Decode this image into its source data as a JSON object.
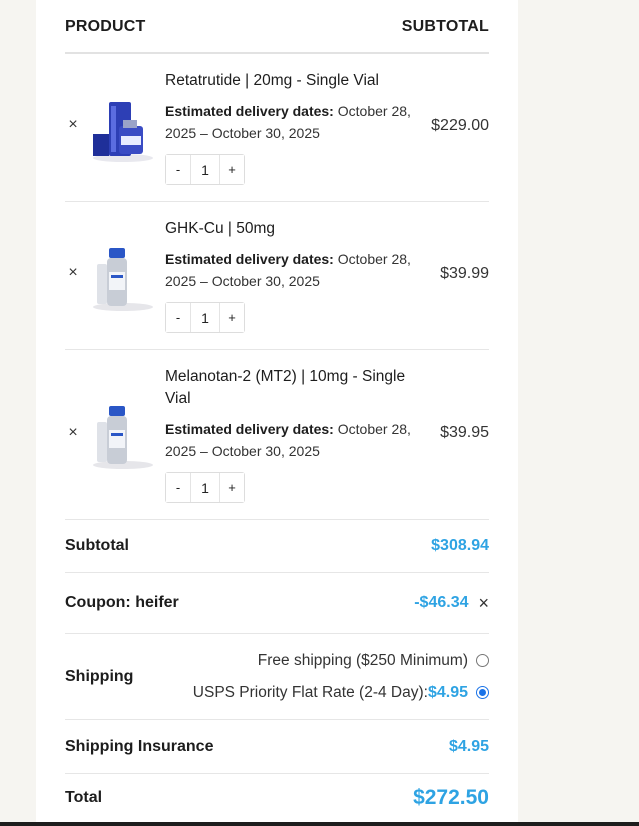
{
  "header": {
    "product": "PRODUCT",
    "subtotal": "SUBTOTAL"
  },
  "items": [
    {
      "name": "Retatrutide | 20mg - Single Vial",
      "delivery_label": "Estimated delivery dates:",
      "delivery_dates": " October 28, 2025 – October 30, 2025",
      "qty": "1",
      "price": "$229.00",
      "remove": "×"
    },
    {
      "name": "GHK-Cu | 50mg",
      "delivery_label": "Estimated delivery dates:",
      "delivery_dates": " October 28, 2025 – October 30, 2025",
      "qty": "1",
      "price": "$39.99",
      "remove": "×"
    },
    {
      "name": "Melanotan-2 (MT2) | 10mg - Single Vial",
      "delivery_label": "Estimated delivery dates:",
      "delivery_dates": " October 28, 2025 – October 30, 2025",
      "qty": "1",
      "price": "$39.95",
      "remove": "×"
    }
  ],
  "qty_controls": {
    "minus": "-",
    "plus": "+"
  },
  "totals": {
    "subtotal_label": "Subtotal",
    "subtotal_value": "$308.94",
    "coupon_label": "Coupon: heifer",
    "coupon_value": "-$46.34",
    "coupon_remove": "×",
    "shipping_label": "Shipping",
    "shipping_options": [
      {
        "label": "Free shipping ($250 Minimum)",
        "price": "",
        "selected": false
      },
      {
        "label": "USPS Priority Flat Rate (2-4 Day): ",
        "price": "$4.95",
        "selected": true
      }
    ],
    "insurance_label": "Shipping Insurance",
    "insurance_value": "$4.95",
    "total_label": "Total",
    "total_value": "$272.50"
  },
  "colors": {
    "accent": "#2ea3e3",
    "radio": "#1a73e8",
    "background": "#f6f5f1"
  }
}
